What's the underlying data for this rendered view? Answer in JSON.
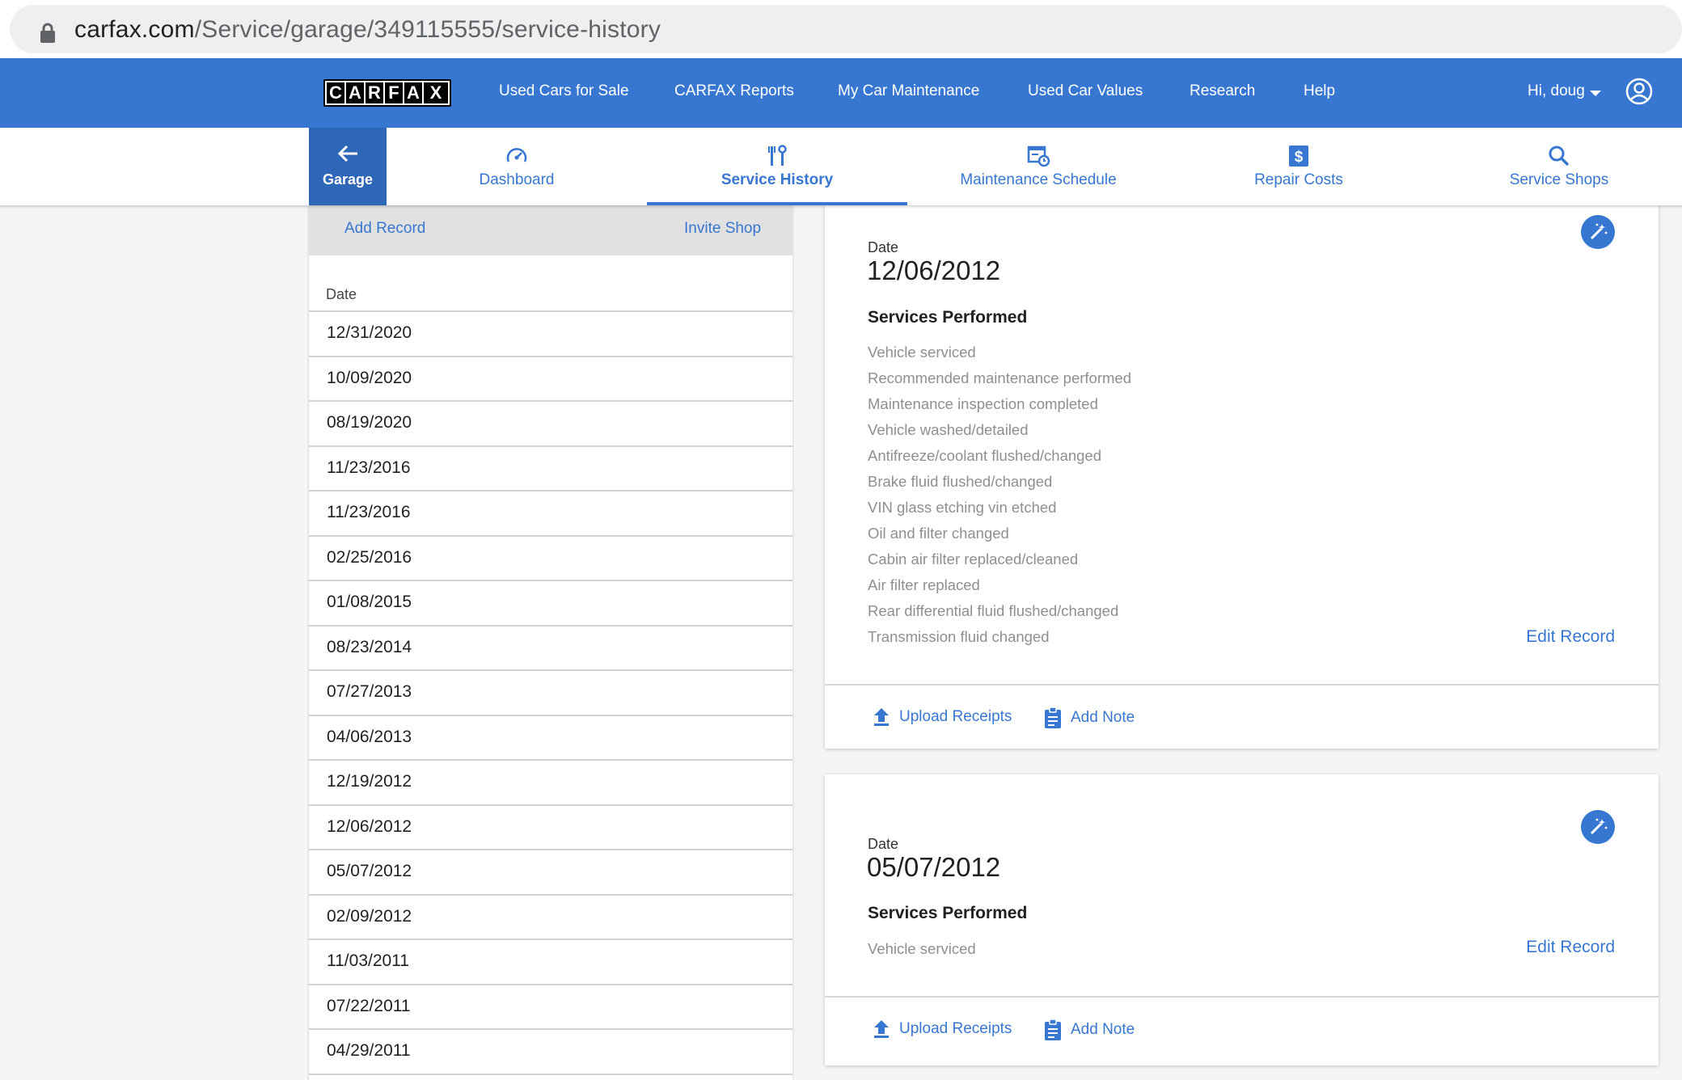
{
  "browser": {
    "url_host": "carfax.com",
    "url_path": "/Service/garage/349115555/service-history"
  },
  "navbar": {
    "logo": "CARFAX",
    "links": [
      "Used Cars for Sale",
      "CARFAX Reports",
      "My Car Maintenance",
      "Used Car Values",
      "Research",
      "Help"
    ],
    "greeting": "Hi, doug"
  },
  "subnav": {
    "garage": "Garage",
    "tabs": [
      {
        "label": "Dashboard",
        "icon": "speedometer-icon"
      },
      {
        "label": "Service History",
        "icon": "tools-icon",
        "active": true
      },
      {
        "label": "Maintenance Schedule",
        "icon": "schedule-icon"
      },
      {
        "label": "Repair Costs",
        "icon": "dollar-icon"
      },
      {
        "label": "Service Shops",
        "icon": "search-icon"
      }
    ]
  },
  "sidebar": {
    "add_record": "Add Record",
    "invite_shop": "Invite Shop",
    "date_header": "Date",
    "dates": [
      "12/31/2020",
      "10/09/2020",
      "08/19/2020",
      "11/23/2016",
      "11/23/2016",
      "02/25/2016",
      "01/08/2015",
      "08/23/2014",
      "07/27/2013",
      "04/06/2013",
      "12/19/2012",
      "12/06/2012",
      "05/07/2012",
      "02/09/2012",
      "11/03/2011",
      "07/22/2011",
      "04/29/2011"
    ]
  },
  "records": [
    {
      "date_label": "Date",
      "date": "12/06/2012",
      "services_header": "Services Performed",
      "services": [
        "Vehicle serviced",
        "Recommended maintenance performed",
        "Maintenance inspection completed",
        "Vehicle washed/detailed",
        "Antifreeze/coolant flushed/changed",
        "Brake fluid flushed/changed",
        "VIN glass etching vin etched",
        "Oil and filter changed",
        "Cabin air filter replaced/cleaned",
        "Air filter replaced",
        "Rear differential fluid flushed/changed",
        "Transmission fluid changed"
      ],
      "edit_label": "Edit Record",
      "upload_label": "Upload Receipts",
      "note_label": "Add Note"
    },
    {
      "date_label": "Date",
      "date": "05/07/2012",
      "services_header": "Services Performed",
      "services": [
        "Vehicle serviced"
      ],
      "edit_label": "Edit Record",
      "upload_label": "Upload Receipts",
      "note_label": "Add Note"
    }
  ],
  "colors": {
    "brand_blue": "#3777d2",
    "garage_blue": "#2e66b8"
  }
}
